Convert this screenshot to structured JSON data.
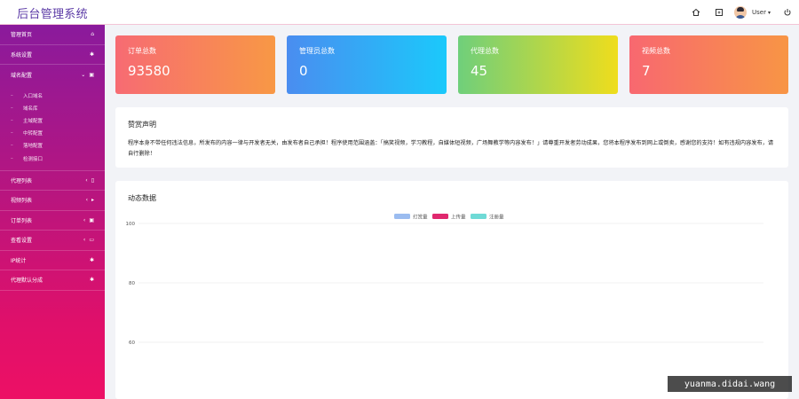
{
  "app": {
    "title": "后台管理系统"
  },
  "topbar": {
    "icons": [
      "home-icon",
      "fullscreen-icon"
    ],
    "user_name": "User",
    "power_icon": "power-icon"
  },
  "sidebar": {
    "items": [
      {
        "label": "管理首页",
        "icon": "home-icon"
      },
      {
        "label": "系统设置",
        "icon": "gear-icon"
      },
      {
        "label": "域名配置",
        "icon": "calendar-icon",
        "expanded": true,
        "children": [
          "入口域名",
          "域名库",
          "主域配置",
          "中转配置",
          "落地配置",
          "检测接口"
        ]
      },
      {
        "label": "代理列表",
        "icon": "phone-icon"
      },
      {
        "label": "视频列表",
        "icon": "play-icon"
      },
      {
        "label": "订单列表",
        "icon": "calendar-icon"
      },
      {
        "label": "查看设置",
        "icon": "laptop-icon"
      },
      {
        "label": "IP统计",
        "icon": "gear-icon"
      },
      {
        "label": "代理默认分成",
        "icon": "gear-icon"
      }
    ]
  },
  "stats": [
    {
      "title": "订单总数",
      "value": "93580"
    },
    {
      "title": "管理员总数",
      "value": "0"
    },
    {
      "title": "代理总数",
      "value": "45"
    },
    {
      "title": "视频总数",
      "value": "7"
    }
  ],
  "notice": {
    "title": "赞赏声明",
    "text": "程序本身不带任何违法信息，所发布的内容一律与开发者无关，由发布者自己承担！程序使用范围涵盖：「搞笑视频，学习教程，自媒体短视频，广场舞教学等内容发布！」请尊重开发者劳动成果，您将本程序发布到网上或倒卖，感谢您的支持！如有违规内容发布，请自行删除！"
  },
  "chart_data": {
    "type": "line",
    "title": "动态数据",
    "legend": [
      "打赏量",
      "上传量",
      "注册量"
    ],
    "legend_colors": [
      "#9bbcf0",
      "#e0286e",
      "#6fdad6"
    ],
    "y_ticks": [
      100,
      80,
      60
    ],
    "ylim": [
      60,
      100
    ],
    "grid": true,
    "legend_position": "top-center",
    "series": []
  },
  "watermark": "yuanma.didai.wang"
}
